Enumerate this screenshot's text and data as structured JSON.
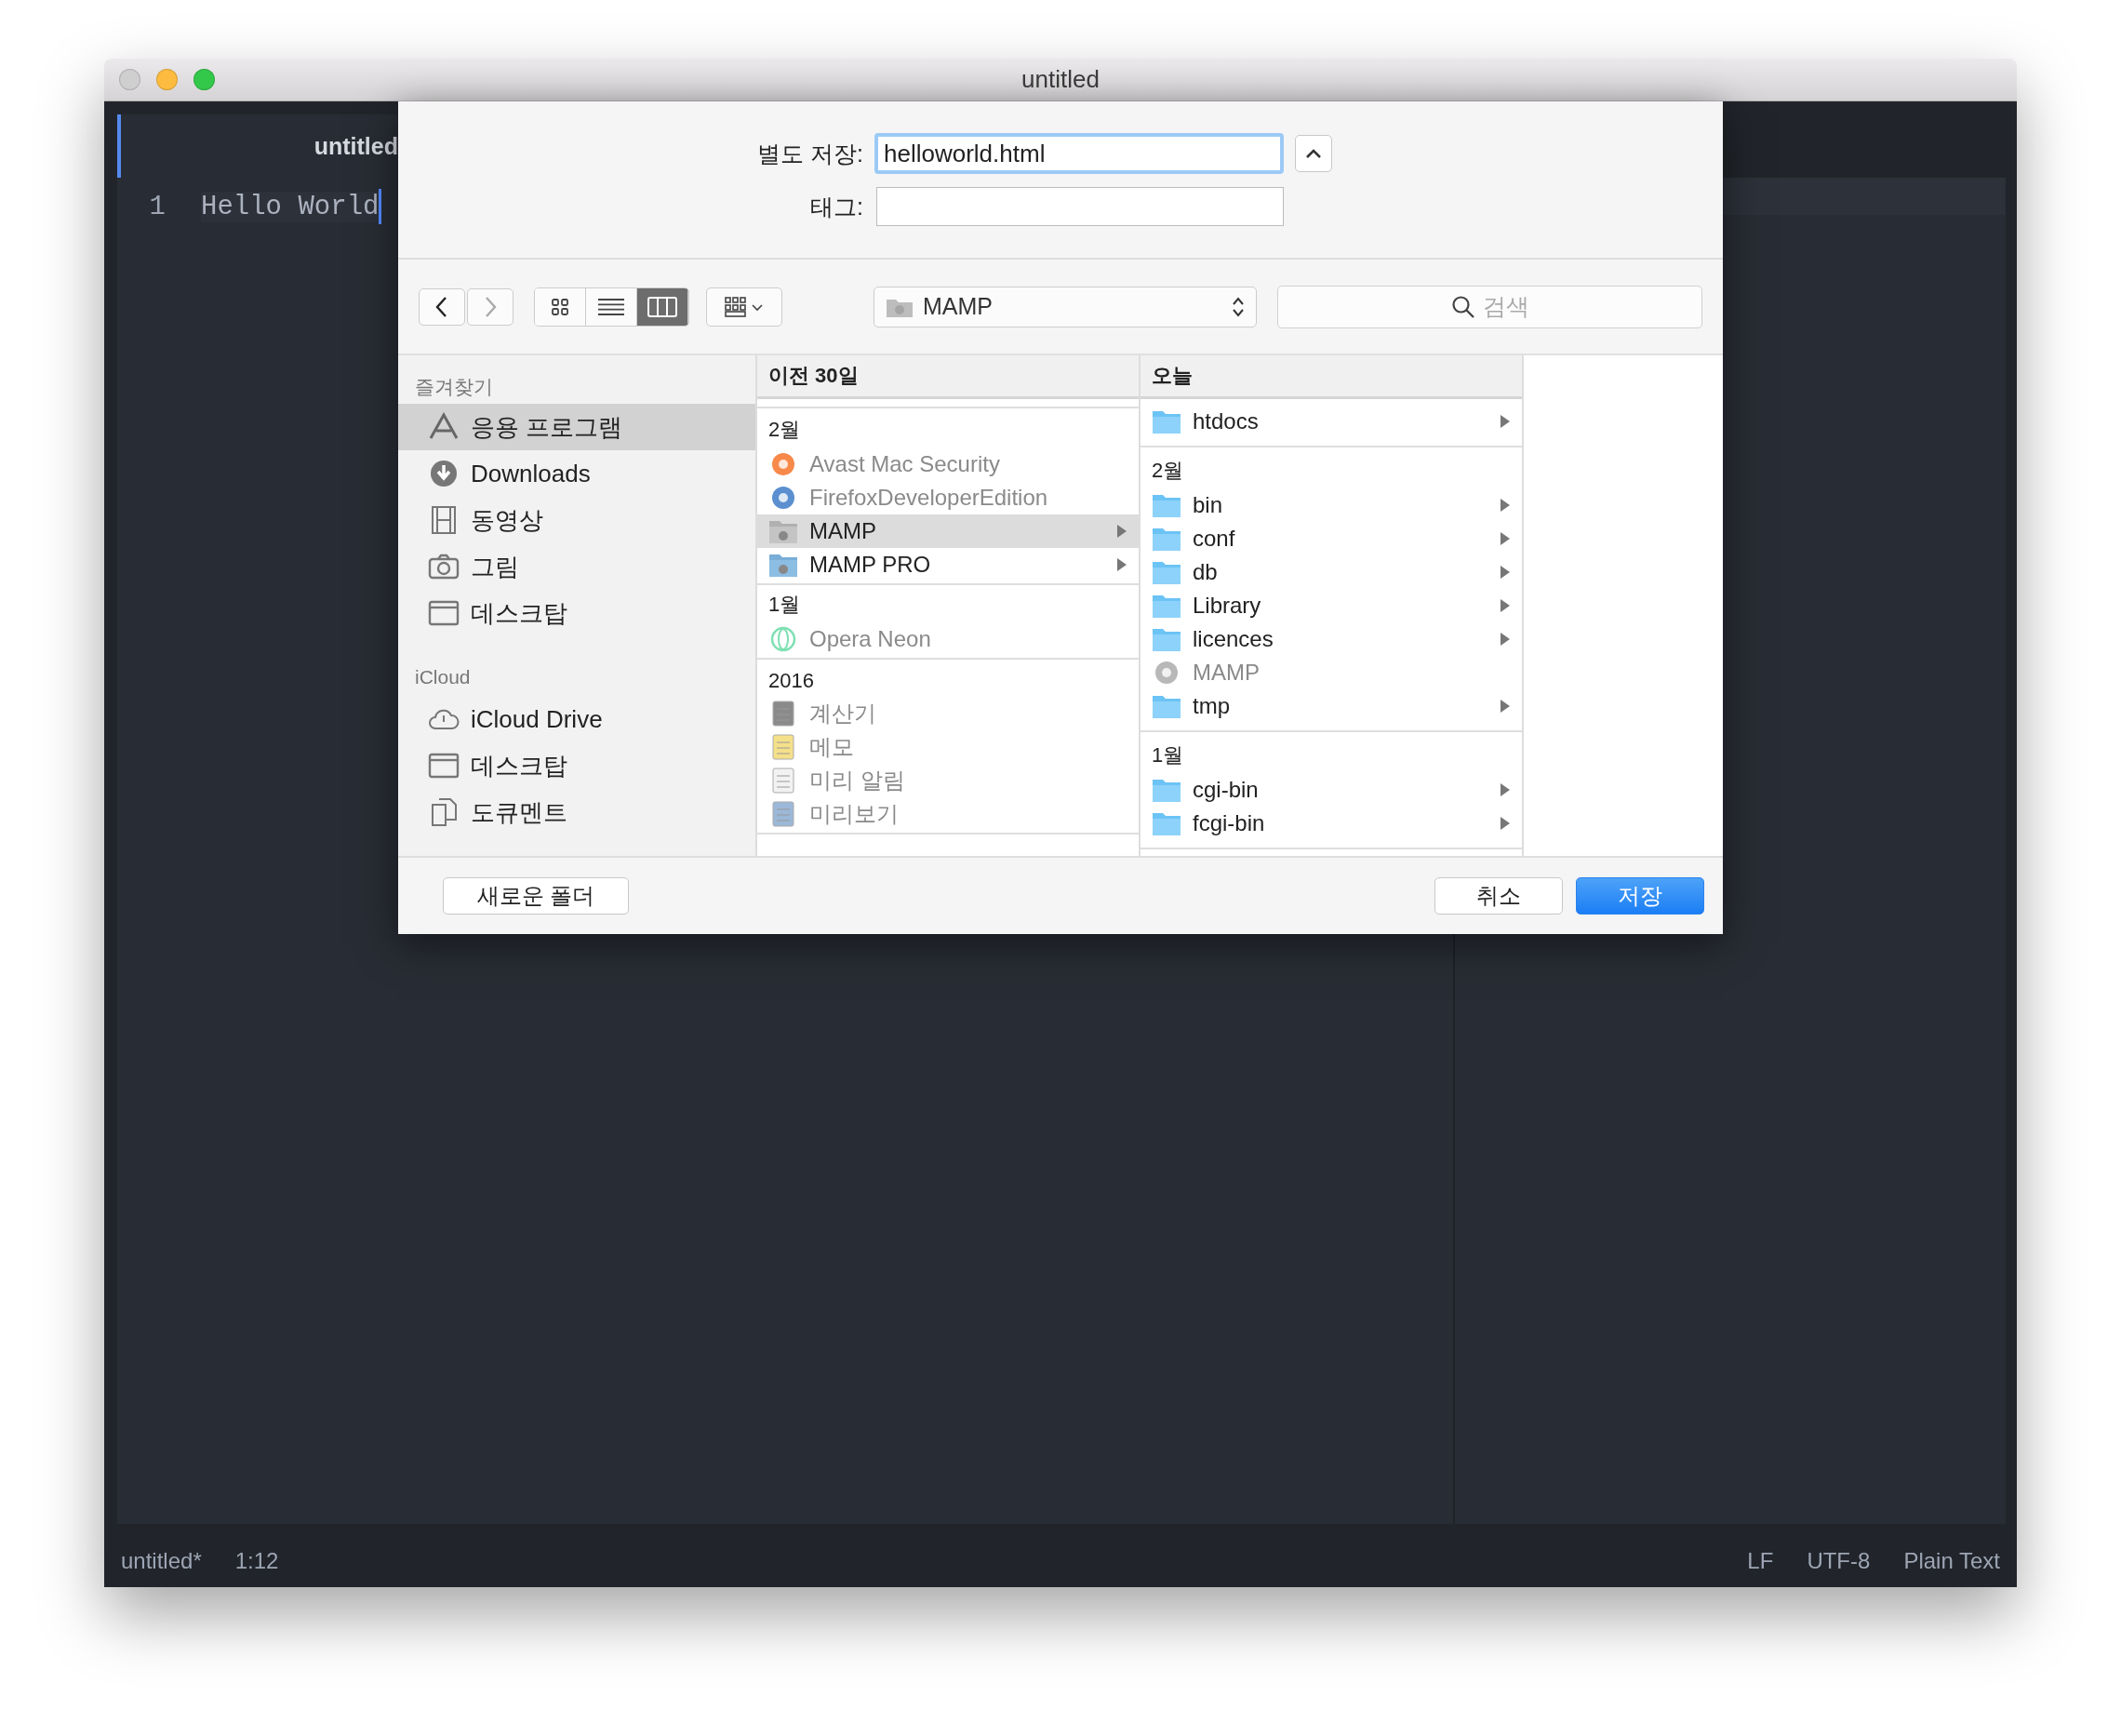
{
  "window": {
    "title": "untitled",
    "controls": [
      {
        "kind": "close",
        "disabled": true
      },
      {
        "kind": "minimize",
        "disabled": false
      },
      {
        "kind": "zoom",
        "disabled": false
      }
    ]
  },
  "editor": {
    "tab": "untitled",
    "lines": [
      {
        "number": "1",
        "text": "Hello World"
      }
    ]
  },
  "save_dialog": {
    "save_as_label": "별도 저장:",
    "filename": "helloworld.html",
    "tags_label": "태그:",
    "location": "MAMP",
    "search": {
      "placeholder": "검색"
    },
    "view_modes": [
      {
        "kind": "icons",
        "selected": false
      },
      {
        "kind": "list",
        "selected": false
      },
      {
        "kind": "columns",
        "selected": true
      }
    ],
    "sidebar": [
      {
        "heading": "즐겨찾기",
        "items": [
          {
            "label": "응용 프로그램",
            "kind": "apps",
            "selected": true
          },
          {
            "label": "Downloads",
            "kind": "download",
            "selected": false
          },
          {
            "label": "동영상",
            "kind": "film",
            "selected": false
          },
          {
            "label": "그림",
            "kind": "camera",
            "selected": false
          },
          {
            "label": "데스크탑",
            "kind": "desktop",
            "selected": false
          }
        ]
      },
      {
        "heading": "iCloud",
        "items": [
          {
            "label": "iCloud Drive",
            "kind": "cloud",
            "selected": false
          },
          {
            "label": "데스크탑",
            "kind": "desktop",
            "selected": false
          },
          {
            "label": "도큐멘트",
            "kind": "documents",
            "selected": false
          }
        ]
      }
    ],
    "columns": [
      {
        "header": "이전 30일",
        "groups": [
          {
            "label": "2월",
            "items": [
              {
                "name": "Avast Mac Security",
                "kind": "avast",
                "dimmed": true,
                "selected": false,
                "has_children": false
              },
              {
                "name": "FirefoxDeveloperEdition",
                "kind": "firefox",
                "dimmed": true,
                "selected": false,
                "has_children": false
              },
              {
                "name": "MAMP",
                "kind": "mamp-folder",
                "dimmed": false,
                "selected": true,
                "has_children": true
              },
              {
                "name": "MAMP PRO",
                "kind": "mamp-folder",
                "dimmed": false,
                "selected": false,
                "has_children": true
              }
            ]
          },
          {
            "label": "1월",
            "items": [
              {
                "name": "Opera Neon",
                "kind": "opera",
                "dimmed": true,
                "selected": false,
                "has_children": false
              }
            ]
          },
          {
            "label": "2016",
            "items": [
              {
                "name": "계산기",
                "kind": "calculator",
                "dimmed": true,
                "selected": false,
                "has_children": false
              },
              {
                "name": "메모",
                "kind": "notes",
                "dimmed": true,
                "selected": false,
                "has_children": false
              },
              {
                "name": "미리 알림",
                "kind": "reminders",
                "dimmed": true,
                "selected": false,
                "has_children": false
              },
              {
                "name": "미리보기",
                "kind": "preview",
                "dimmed": true,
                "selected": false,
                "has_children": false
              }
            ]
          }
        ]
      },
      {
        "header": "오늘",
        "groups": [
          {
            "items": [
              {
                "name": "htdocs",
                "kind": "folder",
                "dimmed": false,
                "selected": false,
                "has_children": true
              }
            ]
          },
          {
            "label": "2월",
            "items": [
              {
                "name": "bin",
                "kind": "folder",
                "dimmed": false,
                "selected": false,
                "has_children": true
              },
              {
                "name": "conf",
                "kind": "folder",
                "dimmed": false,
                "selected": false,
                "has_children": true
              },
              {
                "name": "db",
                "kind": "folder",
                "dimmed": false,
                "selected": false,
                "has_children": true
              },
              {
                "name": "Library",
                "kind": "folder",
                "dimmed": false,
                "selected": false,
                "has_children": true
              },
              {
                "name": "licences",
                "kind": "folder",
                "dimmed": false,
                "selected": false,
                "has_children": true
              },
              {
                "name": "MAMP",
                "kind": "mamp",
                "dimmed": true,
                "selected": false,
                "has_children": false
              },
              {
                "name": "tmp",
                "kind": "folder",
                "dimmed": false,
                "selected": false,
                "has_children": true
              }
            ]
          },
          {
            "label": "1월",
            "items": [
              {
                "name": "cgi-bin",
                "kind": "folder",
                "dimmed": false,
                "selected": false,
                "has_children": true
              },
              {
                "name": "fcgi-bin",
                "kind": "folder",
                "dimmed": false,
                "selected": false,
                "has_children": true
              }
            ]
          }
        ]
      }
    ],
    "buttons": [
      {
        "label": "새로운 폴더",
        "kind": "secondary"
      },
      {
        "label": "취소",
        "kind": "cancel"
      },
      {
        "label": "저장",
        "kind": "primary"
      }
    ]
  },
  "status_bar": {
    "left": [
      "untitled*",
      "1:12"
    ],
    "right": [
      "LF",
      "UTF-8",
      "Plain Text"
    ]
  }
}
